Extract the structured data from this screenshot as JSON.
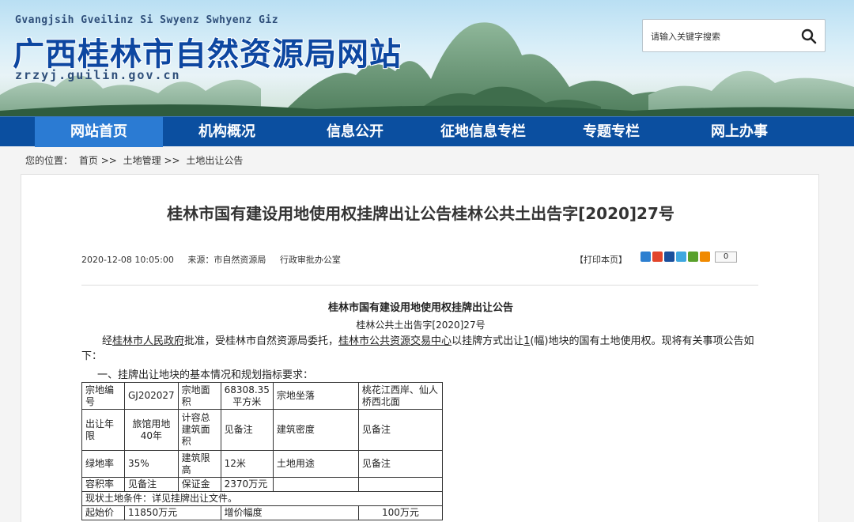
{
  "header": {
    "zhuang_name": "Gvangjsih Gveilinz Si Swyenz Swhyenz Giz",
    "site_title": "广西桂林市自然资源局网站",
    "domain": "zrzyj.guilin.gov.cn",
    "search": {
      "placeholder": "请输入关键字搜索"
    }
  },
  "nav": {
    "items": [
      {
        "label": "网站首页",
        "active": true
      },
      {
        "label": "机构概况"
      },
      {
        "label": "信息公开"
      },
      {
        "label": "征地信息专栏"
      },
      {
        "label": "专题专栏"
      },
      {
        "label": "网上办事"
      }
    ]
  },
  "breadcrumb": {
    "prefix": "您的位置：",
    "items": [
      "首页",
      ">>",
      "土地管理",
      ">>",
      "土地出让公告"
    ]
  },
  "article": {
    "title": "桂林市国有建设用地使用权挂牌出让公告桂林公共土出告字[2020]27号",
    "date": "2020-12-08 10:05:00",
    "source_label": "来源：",
    "source": "市自然资源局",
    "department": "行政审批办公室",
    "print_label": "【打印本页】",
    "share_count": "0",
    "doc_title": "桂林市国有建设用地使用权挂牌出让公告",
    "doc_number": "桂林公共土出告字[2020]27号",
    "para_1a": "经",
    "para_link1": "桂林市人民政府",
    "para_1b": "批准，受桂林市自然资源局委托，",
    "para_link2": "桂林市公共资源交易中心",
    "para_1c": "以挂牌方式出让",
    "para_link3": "1",
    "para_1d": "(幅)地块的国有土地使用权。现将有关事项公告如下：",
    "section_1": "一、挂牌出让地块的基本情况和规划指标要求："
  },
  "table": {
    "row1": [
      "宗地编号",
      "GJ202027",
      "宗地面积",
      "68308.35平方米",
      "宗地坐落",
      "桃花江西岸、仙人桥西北面"
    ],
    "row2": [
      "出让年限",
      "旅馆用地40年",
      "计容总建筑面积",
      "见备注",
      "建筑密度",
      "见备注"
    ],
    "row3": [
      "绿地率",
      "35%",
      "建筑限高",
      "12米",
      "土地用途",
      "见备注"
    ],
    "row4": [
      "容积率",
      "见备注",
      "保证金",
      "2370万元"
    ],
    "row5": "现状土地条件：详见挂牌出让文件。",
    "row6": [
      "起始价",
      "11850万元",
      "增价幅度",
      "100万元"
    ]
  },
  "colors": {
    "nav_bg": "#0b4fa0",
    "nav_active": "#2b7bd3",
    "title_blue": "#0d47a1"
  }
}
